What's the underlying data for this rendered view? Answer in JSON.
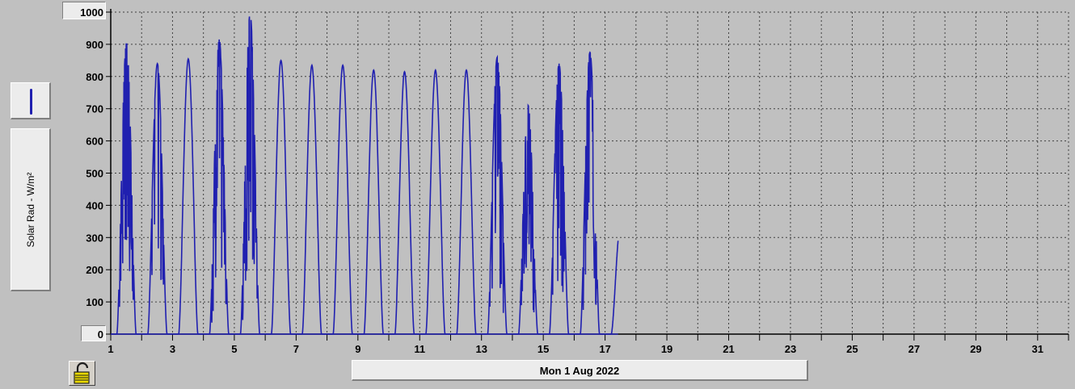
{
  "legend": {
    "series_label": "Solar Rad - W/m²",
    "series_color": "#2020b0"
  },
  "controls": {
    "lock_icon": "padlock-open-icon",
    "date_label": "Mon 1 Aug 2022"
  },
  "chart_data": {
    "type": "line",
    "title": "",
    "xlabel": "",
    "ylabel": "Solar Rad - W/m²",
    "x_unit": "day of month (Aug 2022)",
    "xlim": [
      1,
      32
    ],
    "ylim": [
      0,
      1000
    ],
    "grid": true,
    "grid_style": "dotted",
    "x_ticks": [
      1,
      3,
      5,
      7,
      9,
      11,
      13,
      15,
      17,
      19,
      21,
      23,
      25,
      27,
      29,
      31
    ],
    "y_ticks": [
      0,
      100,
      200,
      300,
      400,
      500,
      600,
      700,
      800,
      900,
      1000
    ],
    "series": [
      {
        "color": "#2020b0",
        "daily_peaks": [
          {
            "day": 1,
            "peak": 905
          },
          {
            "day": 2,
            "peak": 840
          },
          {
            "day": 3,
            "peak": 855
          },
          {
            "day": 4,
            "peak": 915
          },
          {
            "day": 5,
            "peak": 995
          },
          {
            "day": 6,
            "peak": 850
          },
          {
            "day": 7,
            "peak": 835
          },
          {
            "day": 8,
            "peak": 835
          },
          {
            "day": 9,
            "peak": 820
          },
          {
            "day": 10,
            "peak": 815
          },
          {
            "day": 11,
            "peak": 820
          },
          {
            "day": 12,
            "peak": 820
          },
          {
            "day": 13,
            "peak": 860
          },
          {
            "day": 14,
            "peak": 710
          },
          {
            "day": 15,
            "peak": 840
          },
          {
            "day": 16,
            "peak": 875
          },
          {
            "day": 17,
            "peak": 290
          }
        ]
      }
    ]
  }
}
